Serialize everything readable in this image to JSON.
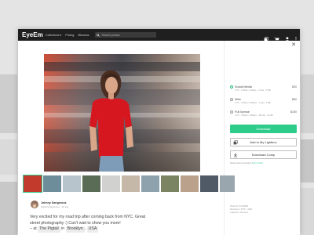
{
  "topbar": {
    "logo": "EyeEm",
    "nav": [
      "Collections ▾",
      "Pricing",
      "Missions"
    ],
    "search_placeholder": "Search photos"
  },
  "photo": {
    "alt": "Woman in red shirt standing in front of a moving bus"
  },
  "purchase": {
    "options": [
      {
        "label": "Social Media",
        "price": "$20",
        "details": "1 Pic · 1700px × 1100px · 72 dpi · 2 MB",
        "selected": true
      },
      {
        "label": "Web",
        "price": "$50",
        "details": "1 Pic · 3700px × 2500px · 72 dpi · 4 MB",
        "selected": false
      },
      {
        "label": "Full license",
        "price": "$100",
        "details": "1 Pic · 5760px × 3840px · 300 dpi · 11 MB",
        "selected": false
      }
    ],
    "download_label": "Download",
    "lightbox_label": "Add to My Lightbox",
    "comp_label": "Download Comp",
    "note_text": "Need custom services?",
    "note_link": "Get in touch",
    "meta": [
      "Photo ID: 97429856",
      "Resolution: 5760 × 3840",
      "Collection: Premium"
    ]
  },
  "author": {
    "name": "Johnny Dangerous",
    "handle": "@johnnydangerous · 2h ago"
  },
  "caption": {
    "text": "Very excited for my road trip after coming back from NYC. Great street photography :) Can't wait to show you more!",
    "prefix": "– at",
    "place": "The Pigtail",
    "in": "in",
    "city": "Brooklyn",
    "sep": ",",
    "country": "USA"
  },
  "colors": {
    "accent": "#2ecc8b",
    "topbar": "#1f1f1f"
  }
}
